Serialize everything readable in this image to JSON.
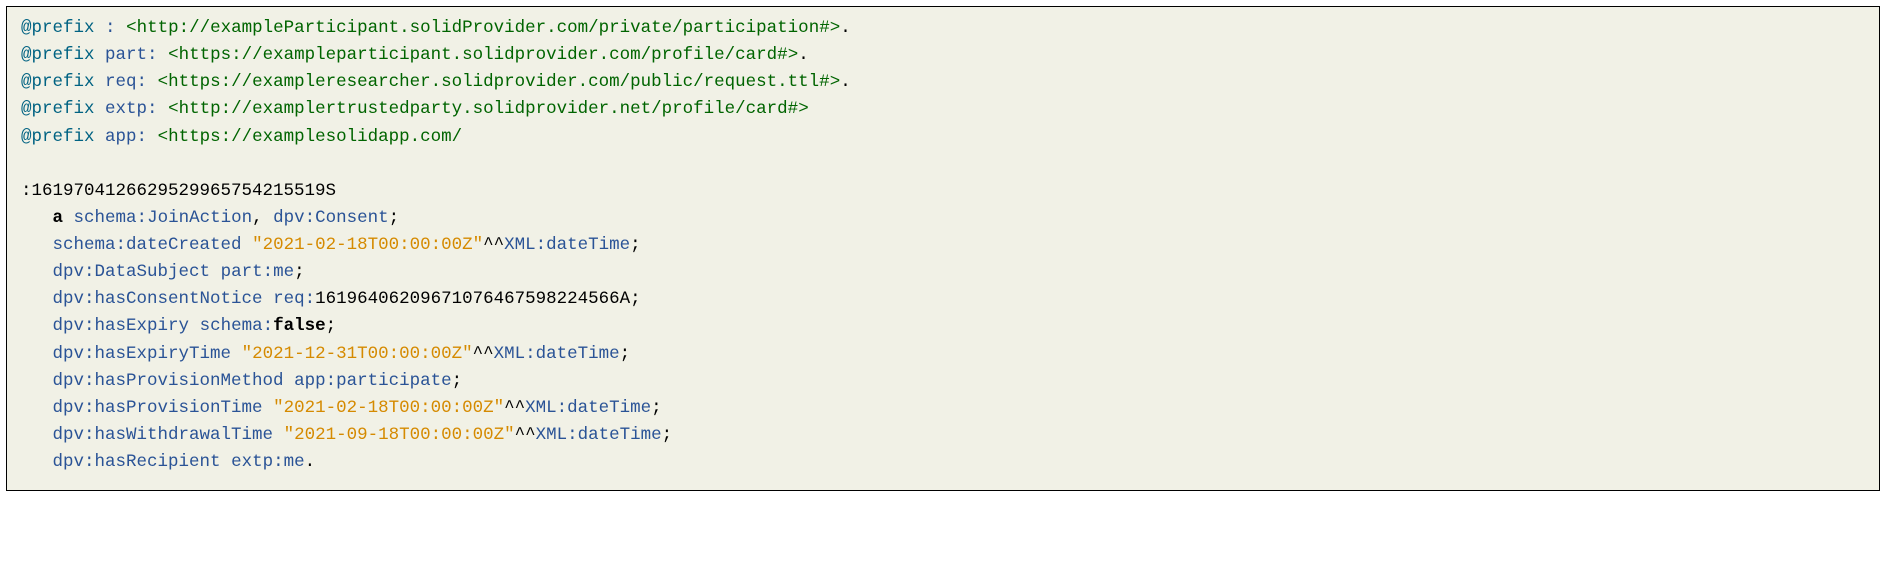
{
  "prefixes": [
    {
      "at": "@prefix",
      "name": ":",
      "open": "<",
      "url": "http://exampleParticipant.solidProvider.com/private/participation#",
      "close": ">",
      "dot": "."
    },
    {
      "at": "@prefix",
      "name": "part:",
      "open": "<",
      "url": "https://exampleparticipant.solidprovider.com/profile/card#",
      "close": ">",
      "dot": "."
    },
    {
      "at": "@prefix",
      "name": "req:",
      "open": "<",
      "url": "https://exampleresearcher.solidprovider.com/public/request.ttl#",
      "close": ">",
      "dot": "."
    },
    {
      "at": "@prefix",
      "name": "extp:",
      "open": "<",
      "url": "http://examplertrustedparty.solidprovider.net/profile/card#",
      "close": ">",
      "dot": ""
    },
    {
      "at": "@prefix",
      "name": "app:",
      "open": "<",
      "url": "https://examplesolidapp.com/",
      "close": "",
      "dot": ""
    }
  ],
  "subject": ":1619704126629529965754215519S",
  "lines": {
    "l1": {
      "indent": "   ",
      "kw": "a",
      "sp": " ",
      "p1a": "schema:",
      "p1b": "JoinAction",
      "comma": ", ",
      "p2a": "dpv:",
      "p2b": "Consent",
      "end": ";"
    },
    "l2": {
      "indent": "   ",
      "preda": "schema:",
      "predb": "dateCreated",
      "sp": " ",
      "lit": "\"2021-02-18T00:00:00Z\"",
      "caret": "^^",
      "typa": "XML:",
      "typb": "dateTime",
      "end": ";"
    },
    "l3": {
      "indent": "   ",
      "preda": "dpv:",
      "predb": "DataSubject",
      "sp": " ",
      "obja": "part:",
      "objb": "me",
      "end": ";"
    },
    "l4": {
      "indent": "   ",
      "preda": "dpv:",
      "predb": "hasConsentNotice",
      "sp": " ",
      "obja": "req:",
      "objb": "16196406209671076467598224566A",
      "end": ";"
    },
    "l5": {
      "indent": "   ",
      "preda": "dpv:",
      "predb": "hasExpiry",
      "sp": " ",
      "obja": "schema:",
      "objb": "false",
      "end": ";"
    },
    "l6": {
      "indent": "   ",
      "preda": "dpv:",
      "predb": "hasExpiryTime",
      "sp": " ",
      "lit": "\"2021-12-31T00:00:00Z\"",
      "caret": "^^",
      "typa": "XML:",
      "typb": "dateTime",
      "end": ";"
    },
    "l7": {
      "indent": "   ",
      "preda": "dpv:",
      "predb": "hasProvisionMethod",
      "sp": " ",
      "obja": "app:",
      "objb": "participate",
      "end": ";"
    },
    "l8": {
      "indent": "   ",
      "preda": "dpv:",
      "predb": "hasProvisionTime",
      "sp": " ",
      "lit": "\"2021-02-18T00:00:00Z\"",
      "caret": "^^",
      "typa": "XML:",
      "typb": "dateTime",
      "end": ";"
    },
    "l9": {
      "indent": "   ",
      "preda": "dpv:",
      "predb": "hasWithdrawalTime",
      "sp": " ",
      "lit": "\"2021-09-18T00:00:00Z\"",
      "caret": "^^",
      "typa": "XML:",
      "typb": "dateTime",
      "end": ";"
    },
    "l10": {
      "indent": "   ",
      "preda": "dpv:",
      "predb": "hasRecipient",
      "sp": " ",
      "obja": "extp:",
      "objb": "me",
      "end": "."
    }
  }
}
